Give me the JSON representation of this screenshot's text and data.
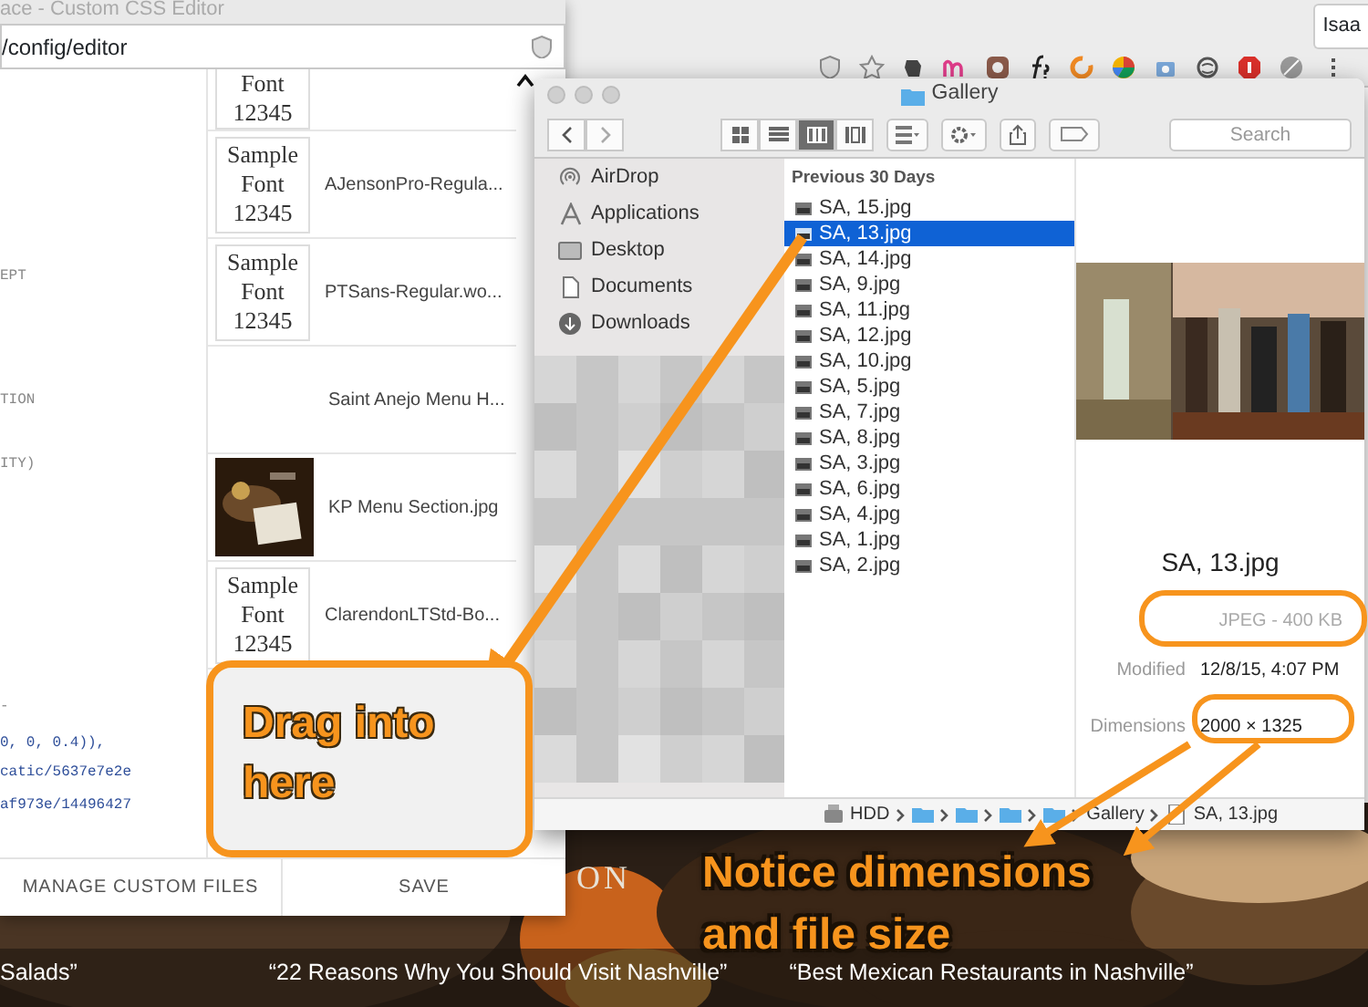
{
  "browser": {
    "user_button": "Isaa"
  },
  "editor": {
    "title": "ace - Custom CSS Editor",
    "url": "/config/editor",
    "code_lines": [
      {
        "kind": "comment",
        "text": "EPT"
      },
      {
        "kind": "comment",
        "text": "TION"
      },
      {
        "kind": "comment",
        "text": "ITY)"
      },
      {
        "kind": "comment",
        "text": "-"
      },
      {
        "kind": "value",
        "text": "0, 0, 0.4)),"
      },
      {
        "kind": "value",
        "text": "catic/5637e7e2e"
      },
      {
        "kind": "value",
        "text": "af973e/14496427"
      }
    ],
    "files": [
      {
        "kind": "font",
        "thumb": [
          "Font",
          "12345"
        ]
      },
      {
        "kind": "font",
        "thumb": [
          "Sample",
          "Font",
          "12345"
        ],
        "name": "AJensonPro-Regula..."
      },
      {
        "kind": "font",
        "thumb": [
          "Sample",
          "Font",
          "12345"
        ],
        "name": "PTSans-Regular.wo..."
      },
      {
        "kind": "blank",
        "name": "Saint Anejo Menu H..."
      },
      {
        "kind": "picture",
        "name": "KP Menu Section.jpg"
      },
      {
        "kind": "font",
        "thumb": [
          "Sample",
          "Font",
          "12345"
        ],
        "name": "ClarendonLTStd-Bo..."
      }
    ],
    "buttons": [
      "MANAGE CUSTOM FILES",
      "SAVE"
    ]
  },
  "finder": {
    "title": "Gallery",
    "search_placeholder": "Search",
    "views": [
      {
        "selected": false
      },
      {
        "selected": false
      },
      {
        "selected": true
      },
      {
        "selected": false
      }
    ],
    "sidebar": [
      {
        "kind": "airdrop",
        "label": "AirDrop"
      },
      {
        "kind": "apps",
        "label": "Applications"
      },
      {
        "kind": "desktop",
        "label": "Desktop"
      },
      {
        "kind": "documents",
        "label": "Documents"
      },
      {
        "kind": "downloads",
        "label": "Downloads"
      }
    ],
    "section": "Previous 30 Days",
    "files": [
      {
        "name": "SA, 15.jpg",
        "selected": false
      },
      {
        "name": "SA, 13.jpg",
        "selected": true
      },
      {
        "name": "SA, 14.jpg",
        "selected": false
      },
      {
        "name": "SA, 9.jpg",
        "selected": false
      },
      {
        "name": "SA, 11.jpg",
        "selected": false
      },
      {
        "name": "SA, 12.jpg",
        "selected": false
      },
      {
        "name": "SA, 10.jpg",
        "selected": false
      },
      {
        "name": "SA, 5.jpg",
        "selected": false
      },
      {
        "name": "SA, 7.jpg",
        "selected": false
      },
      {
        "name": "SA, 8.jpg",
        "selected": false
      },
      {
        "name": "SA, 3.jpg",
        "selected": false
      },
      {
        "name": "SA, 6.jpg",
        "selected": false
      },
      {
        "name": "SA, 4.jpg",
        "selected": false
      },
      {
        "name": "SA, 1.jpg",
        "selected": false
      },
      {
        "name": "SA, 2.jpg",
        "selected": false
      }
    ],
    "preview": {
      "kind": "picture",
      "name": "SA, 13.jpg",
      "summary": "JPEG - 400 KB",
      "info": [
        {
          "label": "Modified",
          "value": "12/8/15, 4:07 PM"
        },
        {
          "label": "Dimensions",
          "value": "2000 × 1325"
        }
      ]
    },
    "path": [
      {
        "kind": "disk",
        "label": "HDD"
      },
      {
        "kind": "folder"
      },
      {
        "kind": "folder"
      },
      {
        "kind": "folder"
      },
      {
        "kind": "folder"
      },
      {
        "kind": "plain",
        "label": "Gallery"
      },
      {
        "kind": "file",
        "label": "SA, 13.jpg"
      }
    ]
  },
  "annotations": [
    {
      "kind": "callout",
      "text": "Drag into here"
    },
    {
      "kind": "caption",
      "text": "Notice dimensions and file size"
    }
  ],
  "page": {
    "logo_fragment": "ON",
    "headlines": [
      "Salads”",
      "“22 Reasons Why You Should Visit Nashville”",
      "“Best Mexican Restaurants in Nashville”"
    ]
  }
}
